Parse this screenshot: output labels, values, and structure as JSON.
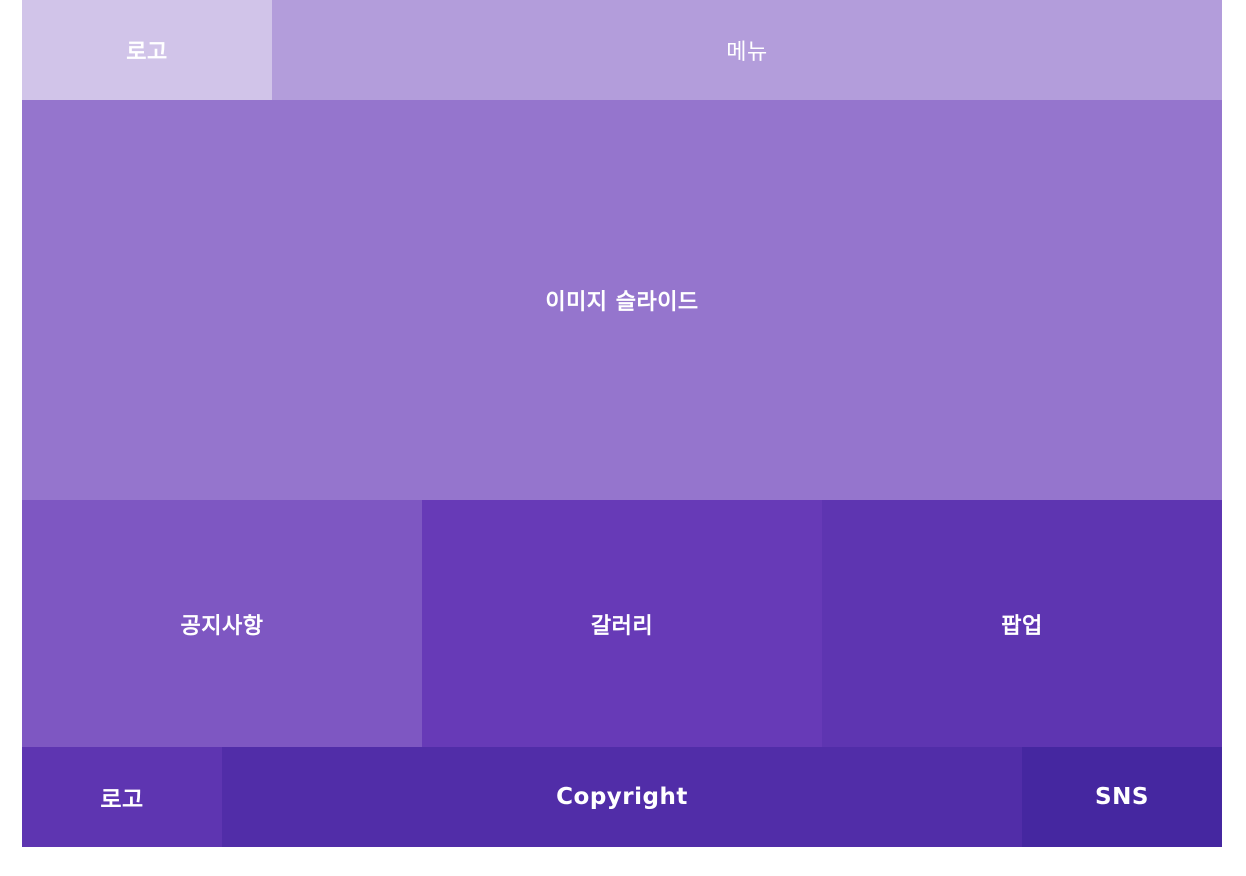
{
  "header": {
    "logo_label": "로고",
    "menu_label": "메뉴"
  },
  "slider": {
    "label": "이미지 슬라이드"
  },
  "content": {
    "notice_label": "공지사항",
    "gallery_label": "갈러리",
    "popup_label": "팝업"
  },
  "footer": {
    "logo_label": "로고",
    "copyright_label": "Copyright",
    "sns_label": "SNS"
  },
  "colors": {
    "header_logo": "#d1c4e9",
    "header_menu": "#b39ddb",
    "slider": "#9575cd",
    "notice": "#7e57c2",
    "gallery": "#673ab7",
    "popup": "#5e35b1",
    "footer_logo": "#5e35b1",
    "copyright": "#512da8",
    "sns": "#4527a0"
  }
}
